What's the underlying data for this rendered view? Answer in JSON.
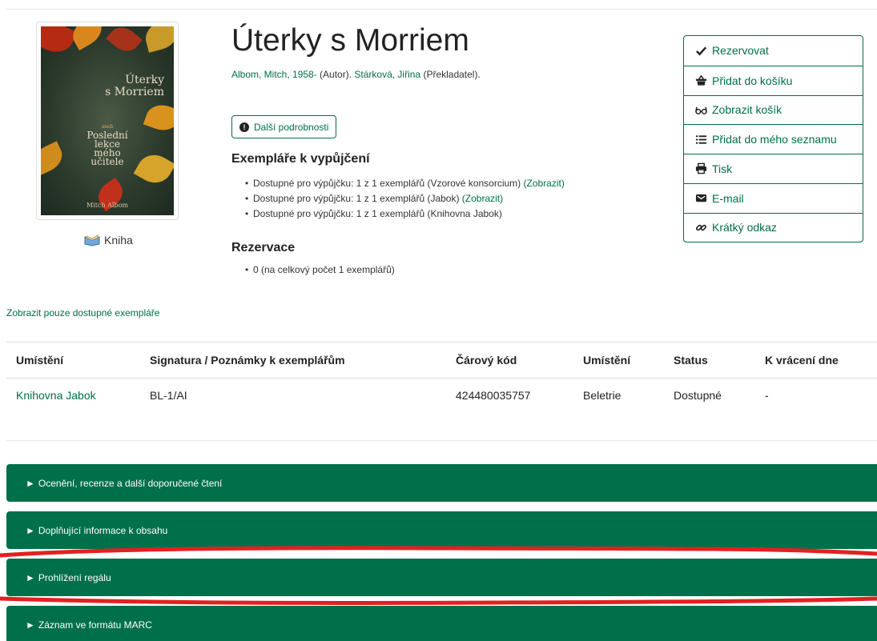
{
  "book": {
    "title": "Úterky s Morriem",
    "author_name": "Albom, Mitch, 1958-",
    "author_role": " (Autor). ",
    "translator_name": "Stárková, Jiřina",
    "translator_role": " (Překladatel).",
    "format": "Kniha"
  },
  "cover": {
    "title_line1": "Úterky",
    "title_line2": "s Morriem",
    "small": "aneb",
    "sub_line1": "Poslední",
    "sub_line2": "lekce",
    "sub_line3": "mého",
    "sub_line4": "učitele",
    "author": "Mitch Albom"
  },
  "more_details": "Další podrobnosti",
  "availability": {
    "heading": "Exempláře k vypůjčení",
    "items": [
      {
        "text": "Dostupné pro výpůjčku: 1 z 1 exemplářů (Vzorové konsorcium) ",
        "link": "(Zobrazit)"
      },
      {
        "text": "Dostupné pro výpůjčku: 1 z 1 exemplářů (Jabok) ",
        "link": "(Zobrazit)"
      },
      {
        "text": "Dostupné pro výpůjčku: 1 z 1 exemplářů (Knihovna Jabok)",
        "link": ""
      }
    ]
  },
  "holds": {
    "heading": "Rezervace",
    "items": [
      "0 (na celkový počet 1 exemplářů)"
    ]
  },
  "actions": [
    {
      "label": "Rezervovat",
      "icon": "check-icon"
    },
    {
      "label": "Přidat do košíku",
      "icon": "basket-icon"
    },
    {
      "label": "Zobrazit košík",
      "icon": "glasses-icon"
    },
    {
      "label": "Přidat do mého seznamu",
      "icon": "list-icon"
    },
    {
      "label": "Tisk",
      "icon": "print-icon"
    },
    {
      "label": "E-mail",
      "icon": "envelope-icon"
    },
    {
      "label": "Krátký odkaz",
      "icon": "link-icon"
    }
  ],
  "show_available_link": "Zobrazit pouze dostupné exempláře",
  "table": {
    "headers": [
      "Umístění",
      "Signatura / Poznámky k exemplářům",
      "Čárový kód",
      "Umístění",
      "Status",
      "K vrácení dne"
    ],
    "rows": [
      [
        "Knihovna Jabok",
        "BL-1/AI",
        "424480035757",
        "Beletrie",
        "Dostupné",
        "-"
      ]
    ]
  },
  "panels": [
    "Ocenění, recenze a další doporučené čtení",
    "Doplňující informace k obsahu",
    "Prohlížení regálu",
    "Záznam ve formátu MARC"
  ],
  "colors": {
    "accent": "#006e4a",
    "panel": "#00704a",
    "annotation": "#e32020"
  }
}
